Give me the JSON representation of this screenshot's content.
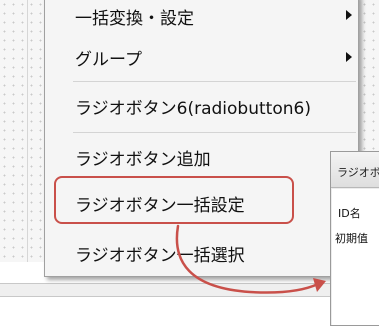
{
  "menu": {
    "items": [
      {
        "label": "一括変換・設定",
        "has_submenu": true
      },
      {
        "label": "グループ",
        "has_submenu": true
      },
      {
        "label": "ラジオボタン6(radiobutton6)",
        "has_submenu": false
      },
      {
        "label": "ラジオボタン追加",
        "has_submenu": false
      },
      {
        "label": "ラジオボタン一括設定",
        "has_submenu": false
      },
      {
        "label": "ラジオボタン一括選択",
        "has_submenu": false
      }
    ]
  },
  "dialog": {
    "title": "ラジオボ",
    "id_label": "ID名",
    "initial_label": "初期值"
  },
  "annotation": {
    "highlight_color": "#c9504a"
  }
}
